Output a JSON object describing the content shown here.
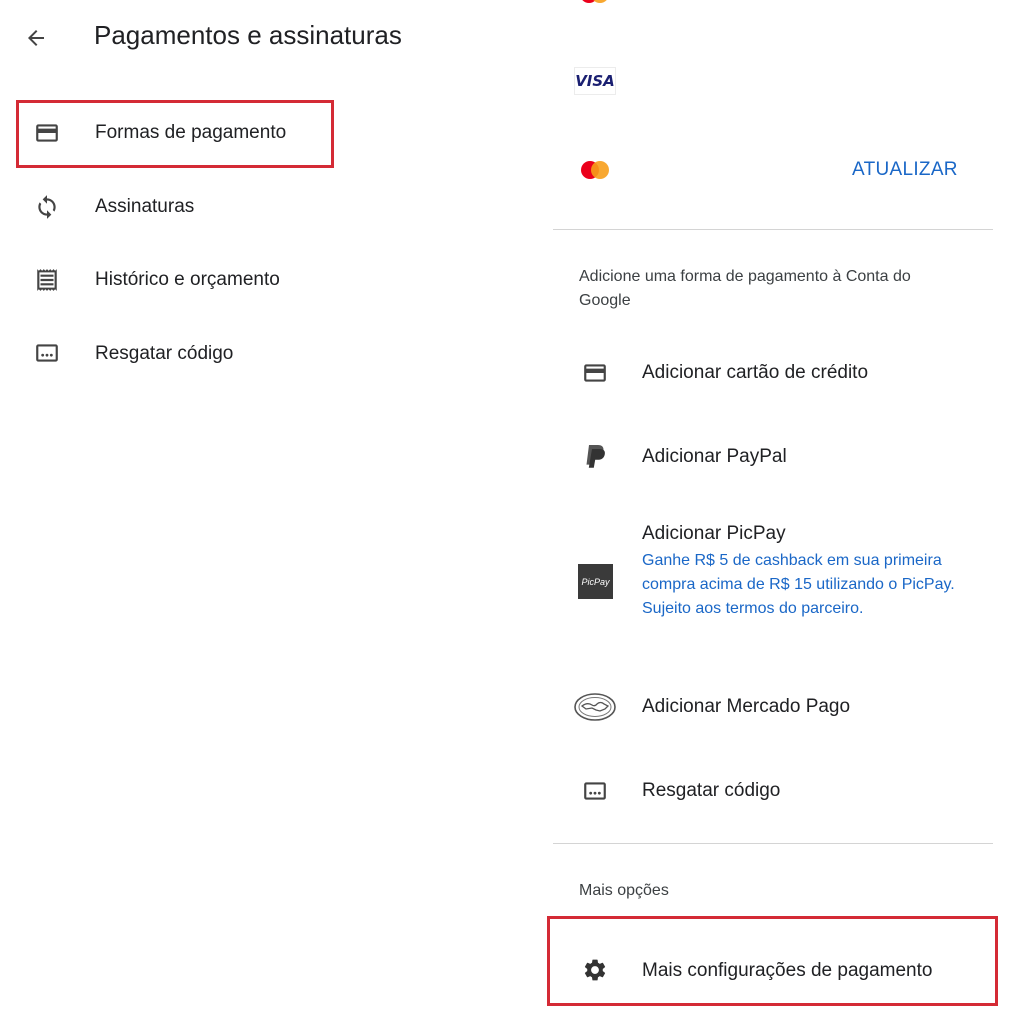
{
  "header": {
    "title": "Pagamentos e assinaturas",
    "back_icon": "arrow-back-icon"
  },
  "left_menu": {
    "items": [
      {
        "label": "Formas de pagamento",
        "icon": "credit-card-icon"
      },
      {
        "label": "Assinaturas",
        "icon": "sync-icon"
      },
      {
        "label": "Histórico e orçamento",
        "icon": "receipt-icon"
      },
      {
        "label": "Resgatar código",
        "icon": "redeem-code-icon"
      }
    ]
  },
  "saved_methods": {
    "visa_label": "VISA",
    "update_label": "ATUALIZAR"
  },
  "add_section": {
    "heading": "Adicione uma forma de pagamento à Conta do Google",
    "options": [
      {
        "label": "Adicionar cartão de crédito",
        "icon": "credit-card-icon"
      },
      {
        "label": "Adicionar PayPal",
        "icon": "paypal-icon"
      },
      {
        "label": "Adicionar PicPay",
        "icon": "picpay-icon",
        "badge": "PicPay",
        "promo": "Ganhe R$ 5 de cashback em sua primeira compra acima de R$ 15 utilizando o PicPay. Sujeito aos termos do parceiro."
      },
      {
        "label": "Adicionar Mercado Pago",
        "icon": "mercado-pago-icon"
      },
      {
        "label": "Resgatar código",
        "icon": "redeem-code-icon"
      }
    ]
  },
  "more_section": {
    "heading": "Mais opções",
    "settings_label": "Mais configurações de pagamento",
    "settings_icon": "gear-icon"
  },
  "colors": {
    "accent_blue": "#1a67c7",
    "highlight_red": "#d42a35",
    "mastercard_red": "#eb001b",
    "mastercard_orange": "#f79e1b"
  }
}
